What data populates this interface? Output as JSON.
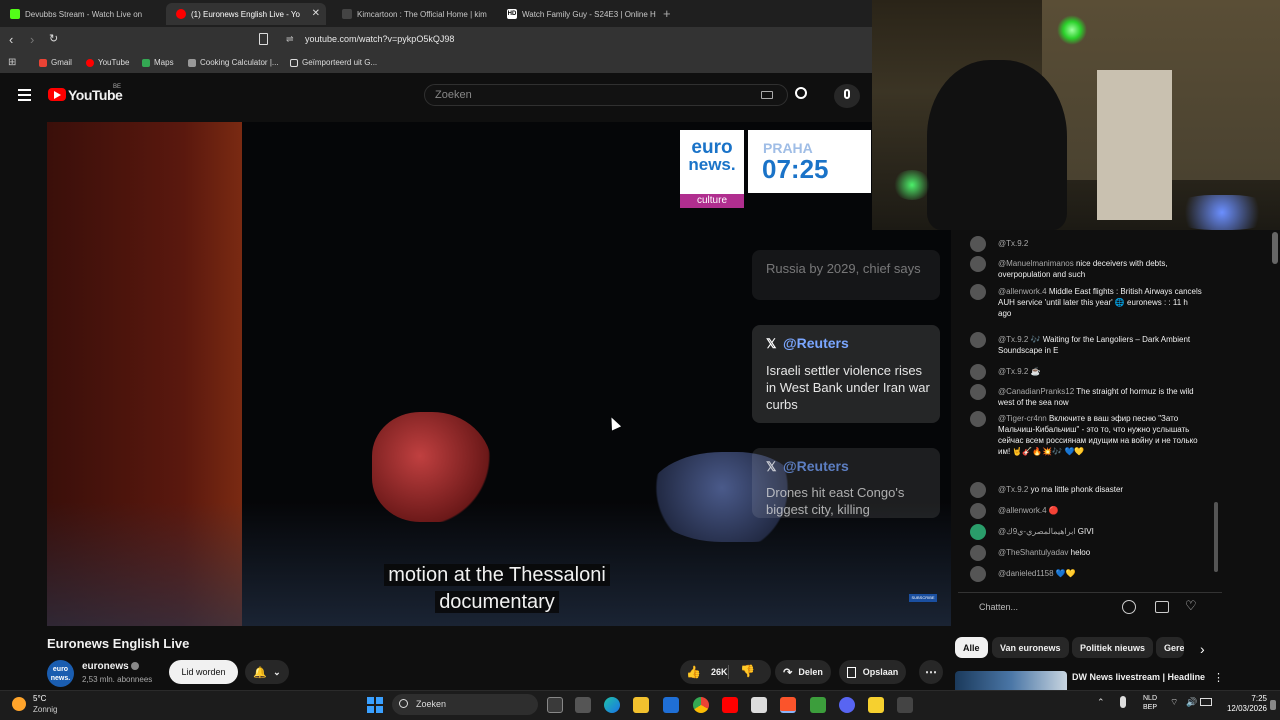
{
  "browser": {
    "tabs": [
      {
        "title": "Devubbs Stream - Watch Live on",
        "color": "#53fc18"
      },
      {
        "title": "(1) Euronews English Live - Yo",
        "color": "#ff0000",
        "active": true
      },
      {
        "title": "Kimcartoon : The Official Home | kim",
        "color": "#444444"
      },
      {
        "title": "Watch Family Guy - S24E3 | Online H",
        "color": "#222222"
      }
    ],
    "address": "youtube.com/watch?v=pykpO5kQJ98",
    "bookmarks": [
      "Gmail",
      "YouTube",
      "Maps",
      "Cooking Calculator |...",
      "Geïmporteerd uit G..."
    ]
  },
  "youtube": {
    "logo": "YouTube",
    "country": "BE",
    "search_placeholder": "Zoeken"
  },
  "player": {
    "brand_line1": "euro",
    "brand_line2": "news.",
    "brand_sub": "culture",
    "clock_city": "PRAHA",
    "clock_time": "07:25",
    "cards": [
      {
        "handle": "",
        "text": "Russia by 2029, chief says"
      },
      {
        "handle": "@Reuters",
        "text": "Israeli settler violence rises in West Bank under Iran war curbs"
      },
      {
        "handle": "@Reuters",
        "text": "Drones hit east Congo's biggest city, killing"
      }
    ],
    "subtitle_line1": "motion at the Thessaloni",
    "subtitle_line2": "documentary",
    "subscribe_badge": "SUBSCRIBE"
  },
  "chat": {
    "messages": [
      {
        "author": "@Tx.9.2",
        "text": ""
      },
      {
        "author": "@Manuelmanimanos",
        "text": "nice deceivers with debts, overpopulation and such"
      },
      {
        "author": "@allenwork.4",
        "text": "Middle East flights : British Airways cancels AUH service 'until later this year' 🌐 euronews : : 11 h ago"
      },
      {
        "author": "@Tx.9.2",
        "text": "🎶 Waiting for the Langoliers – Dark Ambient Soundscape in E"
      },
      {
        "author": "@Tx.9.2",
        "text": "☕"
      },
      {
        "author": "@CanadianPranks12",
        "text": "The straight of hormuz is the wild west of the sea now"
      },
      {
        "author": "@Tiger-cr4nn",
        "text": "Включите в ваш эфир песню \"Зато Мальчиш-Кибальчиш\" - это то, что нужно услышать сейчас всем россиянам идущим на войну и не только им! 🤘🎸🔥💥🎶 💙💛"
      },
      {
        "author": "@Tx.9.2",
        "text": "yo ma little phonk disaster"
      },
      {
        "author": "@allenwork.4",
        "text": "🔴"
      },
      {
        "author": "@ابراهيمالمصري-ي9ك",
        "text": "GIVI"
      },
      {
        "author": "@TheShantulyadav",
        "text": "heloo"
      },
      {
        "author": "@danieled1158",
        "text": "💙💛"
      }
    ],
    "input_placeholder": "Chatten..."
  },
  "video": {
    "title": "Euronews English Live",
    "channel": "euronews",
    "subscribers": "2,53 mln. abonnees",
    "join_label": "Lid worden",
    "likes": "26K",
    "share_label": "Delen",
    "save_label": "Opslaan"
  },
  "chips": [
    "Alle",
    "Van euronews",
    "Politiek nieuws",
    "Gerel"
  ],
  "recommended": {
    "title": "DW News livestream | Headline"
  },
  "taskbar": {
    "temp": "5°C",
    "weather": "Zonnig",
    "search": "Zoeken",
    "lang1": "NLD",
    "lang2": "BEP",
    "time": "7:25",
    "date": "12/03/2026"
  }
}
